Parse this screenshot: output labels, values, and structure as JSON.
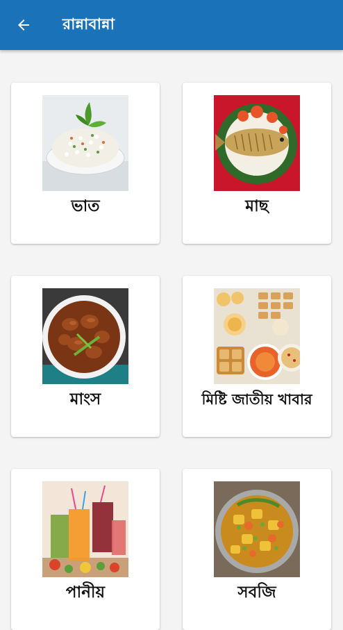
{
  "appbar": {
    "title": "রান্নাবান্না",
    "back_icon": "arrow-left-icon",
    "color": "#1a73b8"
  },
  "categories": [
    {
      "label": "ভাত",
      "image": "rice-bowl-image"
    },
    {
      "label": "মাছ",
      "image": "fish-dish-image"
    },
    {
      "label": "মাংস",
      "image": "meat-curry-image"
    },
    {
      "label": "মিষ্টি জাতীয় খাবার",
      "image": "sweets-platter-image"
    },
    {
      "label": "পানীয়",
      "image": "drinks-glasses-image"
    },
    {
      "label": "সবজি",
      "image": "vegetable-curry-image"
    }
  ]
}
